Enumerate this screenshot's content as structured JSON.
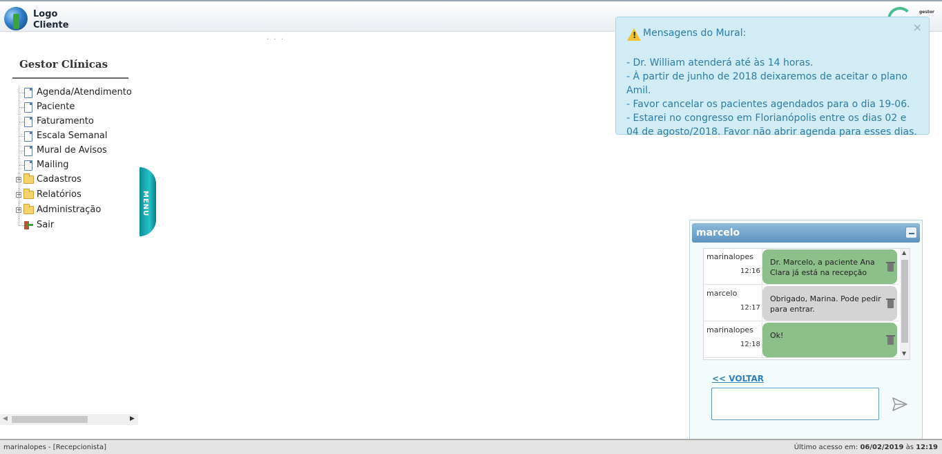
{
  "header": {
    "logo_line1": "Logo",
    "logo_line2": "Cliente",
    "brand_small": "gestor"
  },
  "sidebar": {
    "title": "Gestor Clínicas",
    "items": [
      {
        "label": "Agenda/Atendimento",
        "type": "doc"
      },
      {
        "label": "Paciente",
        "type": "doc"
      },
      {
        "label": "Faturamento",
        "type": "doc"
      },
      {
        "label": "Escala Semanal",
        "type": "doc"
      },
      {
        "label": "Mural de Avisos",
        "type": "doc"
      },
      {
        "label": "Mailing",
        "type": "doc"
      },
      {
        "label": "Cadastros",
        "type": "folder"
      },
      {
        "label": "Relatórios",
        "type": "folder"
      },
      {
        "label": "Administração",
        "type": "folder"
      },
      {
        "label": "Sair",
        "type": "exit"
      }
    ],
    "menu_tab": "MENU"
  },
  "notice": {
    "title": "Mensagens do Mural:",
    "close": "×",
    "lines": [
      "- Dr. William atenderá até às 14 horas.",
      "- À partir de junho de 2018 deixaremos de aceitar o plano Amil.",
      "- Favor cancelar os pacientes agendados para o dia 19-06.",
      "- Estarei no congresso em Florianópolis entre os dias 02 e 04 de agosto/2018. Favor não abrir agenda para esses dias."
    ]
  },
  "chat": {
    "contact": "marcelo",
    "messages": [
      {
        "sender": "marinalopes",
        "time": "12:16",
        "text": "Dr. Marcelo, a paciente Ana Clara já está na recepção",
        "color": "#8dbf8a"
      },
      {
        "sender": "marcelo",
        "time": "12:17",
        "text": "Obrigado, Marina. Pode pedir para entrar.",
        "color": "#d4d4d4"
      },
      {
        "sender": "marinalopes",
        "time": "12:18",
        "text": "Ok!",
        "color": "#8dbf8a"
      }
    ],
    "back_link": "<< VOLTAR",
    "input_value": ""
  },
  "footer": {
    "user": "marinalopes - [Recepcionista]",
    "last_access_label": "Último acesso em:",
    "last_access_date": "06/02/2019",
    "last_access_at": "às",
    "last_access_time": "12:19"
  }
}
